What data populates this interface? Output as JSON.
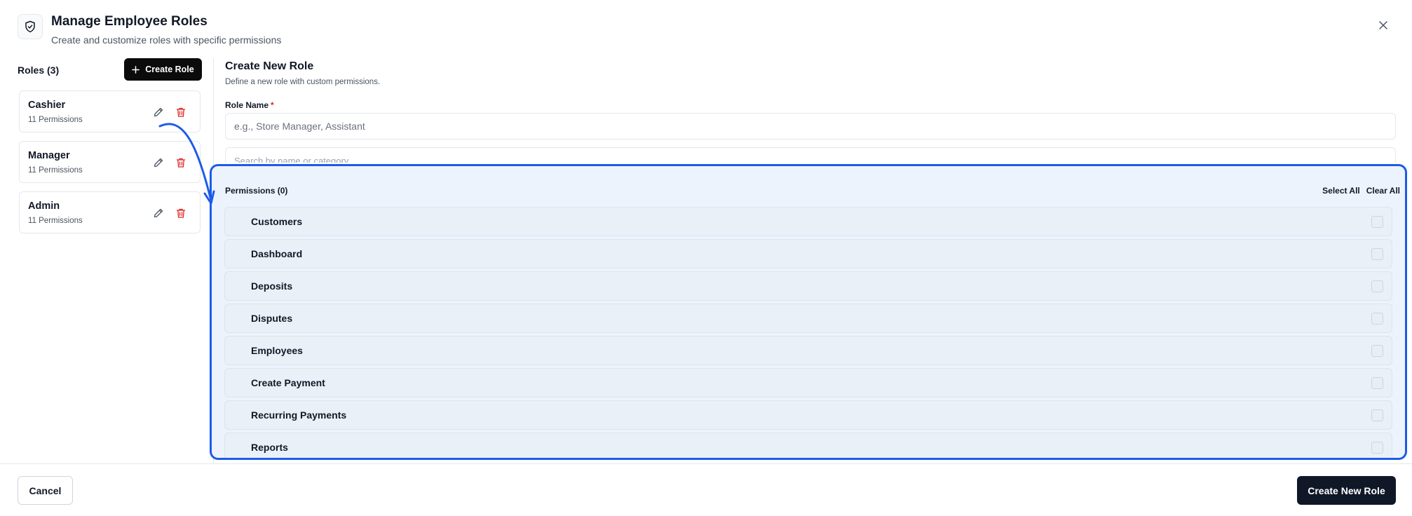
{
  "dialog": {
    "title": "Manage Employee Roles",
    "subtitle": "Create and customize roles with specific permissions",
    "icon": "shield-check-icon"
  },
  "roles_panel": {
    "count_label": "Roles (3)",
    "create_button_label": "Create Role",
    "roles": [
      {
        "name": "Cashier",
        "permissions": "11 Permissions"
      },
      {
        "name": "Manager",
        "permissions": "11 Permissions"
      },
      {
        "name": "Admin",
        "permissions": "11 Permissions"
      }
    ]
  },
  "form": {
    "title": "Create New Role",
    "subtitle": "Define a new role with custom permissions.",
    "role_name_label": "Role Name",
    "required_marker": "*",
    "role_name_placeholder": "e.g., Store Manager, Assistant",
    "role_name_value": "",
    "search_placeholder": "Search by name or category"
  },
  "permissions": {
    "header": "Permissions (0)",
    "select_all_label": "Select All",
    "clear_all_label": "Clear All",
    "items": [
      {
        "label": "Customers",
        "checked": false
      },
      {
        "label": "Dashboard",
        "checked": false
      },
      {
        "label": "Deposits",
        "checked": false
      },
      {
        "label": "Disputes",
        "checked": false
      },
      {
        "label": "Employees",
        "checked": false
      },
      {
        "label": "Create Payment",
        "checked": false
      },
      {
        "label": "Recurring Payments",
        "checked": false
      },
      {
        "label": "Reports",
        "checked": false
      }
    ]
  },
  "footer": {
    "cancel_label": "Cancel",
    "submit_label": "Create New Role"
  },
  "colors": {
    "primary_button": "#0b0b0c",
    "highlight_border": "#1d5ce8",
    "delete_icon": "#dc2626"
  }
}
